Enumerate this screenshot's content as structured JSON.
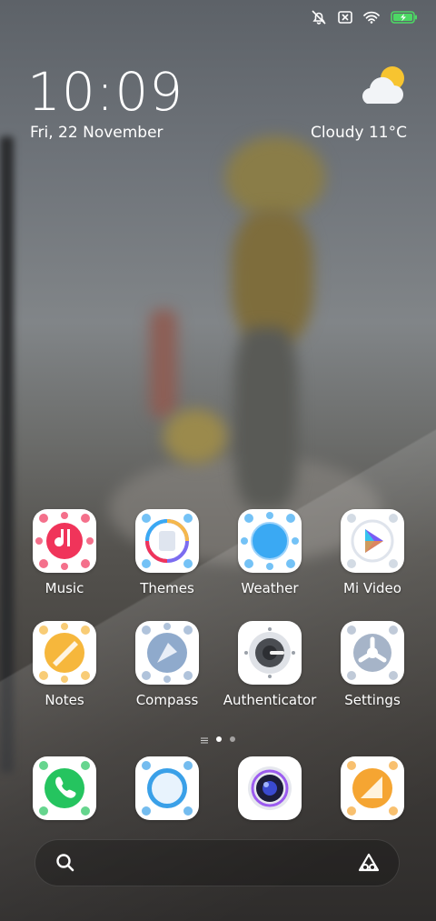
{
  "status_bar": {
    "icons": [
      "alarm-off-icon",
      "no-sim-icon",
      "wifi-icon",
      "battery-charging-icon"
    ],
    "battery_color": "#4cd964"
  },
  "lock": {
    "time": "10:09",
    "date": "Fri, 22 November",
    "weather_text": "Cloudy  11°C",
    "weather_icon": "partly-cloudy-icon"
  },
  "apps_row1": [
    {
      "label": "Music",
      "icon": "music-icon",
      "color": "#f0345a"
    },
    {
      "label": "Themes",
      "icon": "themes-icon",
      "color": "#7b6cf0"
    },
    {
      "label": "Weather",
      "icon": "weather-icon",
      "color": "#3aa9f3"
    },
    {
      "label": "Mi Video",
      "icon": "mi-video-icon",
      "color": "#7a5cf5"
    }
  ],
  "apps_row2": [
    {
      "label": "Notes",
      "icon": "notes-icon",
      "color": "#f6b73c"
    },
    {
      "label": "Compass",
      "icon": "compass-icon",
      "color": "#8faacc"
    },
    {
      "label": "Authenticator",
      "icon": "authenticator-icon",
      "color": "#7a7d82"
    },
    {
      "label": "Settings",
      "icon": "settings-icon",
      "color": "#a6b4c8"
    }
  ],
  "dock": [
    {
      "icon": "phone-icon",
      "color": "#25c45f"
    },
    {
      "icon": "messages-icon",
      "color": "#3aa0e8"
    },
    {
      "icon": "camera-icon",
      "color": "#2d2f5e"
    },
    {
      "icon": "gallery-icon",
      "color": "#f5a532"
    }
  ],
  "pager": {
    "pages": 2,
    "current": 1
  },
  "search_bar": {
    "left_icon": "search-icon",
    "right_icon": "assistant-icon"
  }
}
